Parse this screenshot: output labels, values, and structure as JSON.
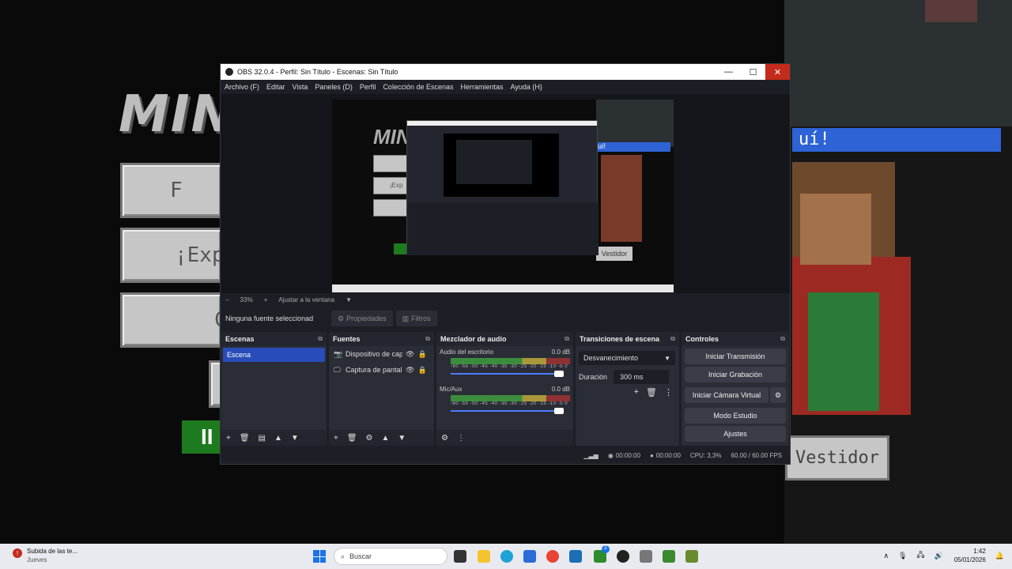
{
  "background_game": {
    "logo_text": "MIN",
    "buttons": [
      "F",
      "¡Expl",
      "C",
      ""
    ],
    "blue_banner": "uí!",
    "vestidor_label": "Vestidor"
  },
  "obs": {
    "title": "OBS 32.0.4 - Perfil: Sin Título - Escenas: Sin Título",
    "window_controls": {
      "minimize": "—",
      "maximize": "☐",
      "close": "✕"
    },
    "menu": [
      "Archivo (F)",
      "Editar",
      "Vista",
      "Paneles (D)",
      "Perfil",
      "Colección de Escenas",
      "Herramientas",
      "Ayuda (H)"
    ],
    "zoom": {
      "minus": "−",
      "value": "33%",
      "plus": "+",
      "fit": "Ajustar a la ventana",
      "dropdown": "▼"
    },
    "no_source": "Ninguna fuente seleccionad",
    "properties_label": "Propiedades",
    "filters_label": "Filtros",
    "preview_texts": {
      "vestidor": "Vestidor",
      "blue": "uí!",
      "btn": "¡Exp"
    },
    "scenes": {
      "title": "Escenas",
      "items": [
        "Escena"
      ],
      "footer": [
        "+",
        "🗑",
        "▤",
        "▲",
        "▼"
      ]
    },
    "sources": {
      "title": "Fuentes",
      "items": [
        {
          "icon": "📷",
          "label": "Dispositivo de cap"
        },
        {
          "icon": "🖵",
          "label": "Captura de pantal"
        }
      ],
      "footer": [
        "+",
        "🗑",
        "⚙",
        "▲",
        "▼"
      ]
    },
    "mixer": {
      "title": "Mezclador de audio",
      "channels": [
        {
          "name": "Audio del escritorio",
          "db": "0.0 dB"
        },
        {
          "name": "Mic/Aux",
          "db": "0.0 dB"
        }
      ],
      "ticks": "-60 -55 -50 -45 -40 -35 -30 -25 -20 -15 -10 -5 0",
      "footer": [
        "⚙",
        "⋮"
      ]
    },
    "transitions": {
      "title": "Transiciones de escena",
      "selected": "Desvanecimiento",
      "duration_label": "Duración",
      "duration_value": "300 ms",
      "controls": [
        "+",
        "🗑",
        "⋮"
      ]
    },
    "controls": {
      "title": "Controles",
      "buttons": [
        "Iniciar Transmisión",
        "Iniciar Grabación",
        "Iniciar Cámara Virtual",
        "Modo Estudio",
        "Ajustes"
      ]
    },
    "status": {
      "stream_time": "00:00:00",
      "rec_time": "00:00:00",
      "cpu": "CPU: 3,3%",
      "fps": "60.00 / 60.00 FPS"
    }
  },
  "taskbar": {
    "news_title": "Subida de las te...",
    "news_sub": "Jueves",
    "news_badge": "!",
    "search_placeholder": "Buscar",
    "time": "1:42",
    "date": "05/01/2026",
    "tray_badge": "2"
  },
  "colors": {
    "accent": "#284cb8",
    "close": "#c42b1c"
  }
}
